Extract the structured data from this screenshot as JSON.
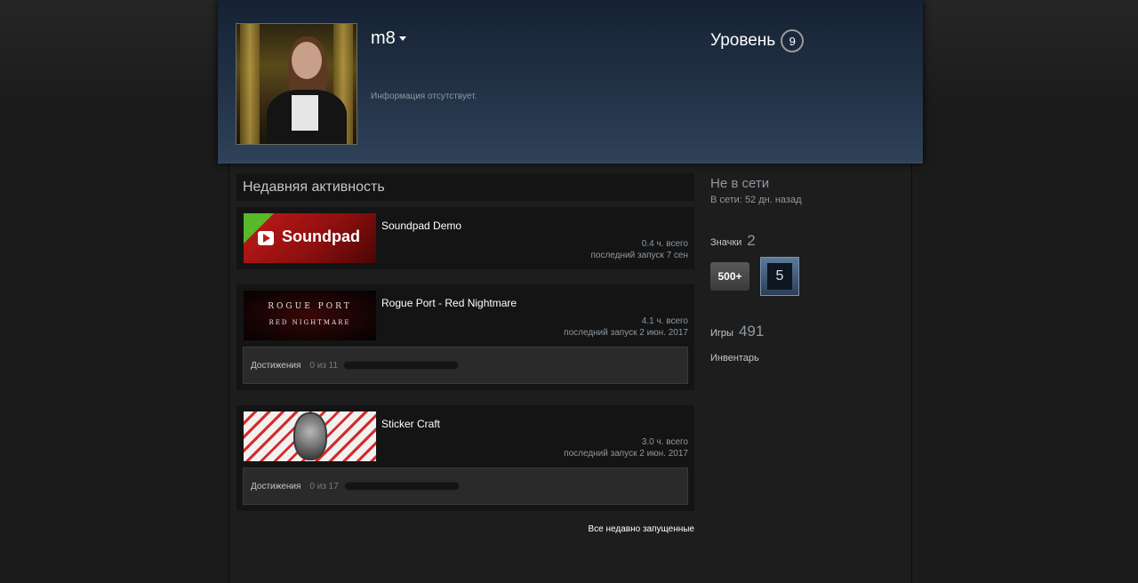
{
  "header": {
    "persona_name": "m8",
    "summary": "Информация отсутствует.",
    "level_label": "Уровень",
    "level_value": "9"
  },
  "activity": {
    "title": "Недавняя активность",
    "games": [
      {
        "name": "Soundpad Demo",
        "capsule_title": "Soundpad",
        "hours": "0.4 ч. всего",
        "last_played": "последний запуск 7 сен"
      },
      {
        "name": "Rogue Port - Red Nightmare",
        "capsule_line1": "ROGUE PORT",
        "capsule_line2": "RED NIGHTMARE",
        "hours": "4.1 ч. всего",
        "last_played": "последний запуск 2 июн. 2017",
        "achievements_label": "Достижения",
        "achievements_count": "0 из 11",
        "achievements_progress": 0
      },
      {
        "name": "Sticker Craft",
        "hours": "3.0 ч. всего",
        "last_played": "последний запуск 2 июн. 2017",
        "achievements_label": "Достижения",
        "achievements_count": "0 из 17",
        "achievements_progress": 0
      }
    ],
    "all_recent_link": "Все недавно запущенные"
  },
  "sidebar": {
    "status": "Не в сети",
    "status_sub": "В сети: 52 дн. назад",
    "badges_label": "Значки",
    "badges_count": "2",
    "badge_items": [
      {
        "text": "500+"
      },
      {
        "text": "5"
      }
    ],
    "games_label": "Игры",
    "games_count": "491",
    "inventory_label": "Инвентарь"
  }
}
